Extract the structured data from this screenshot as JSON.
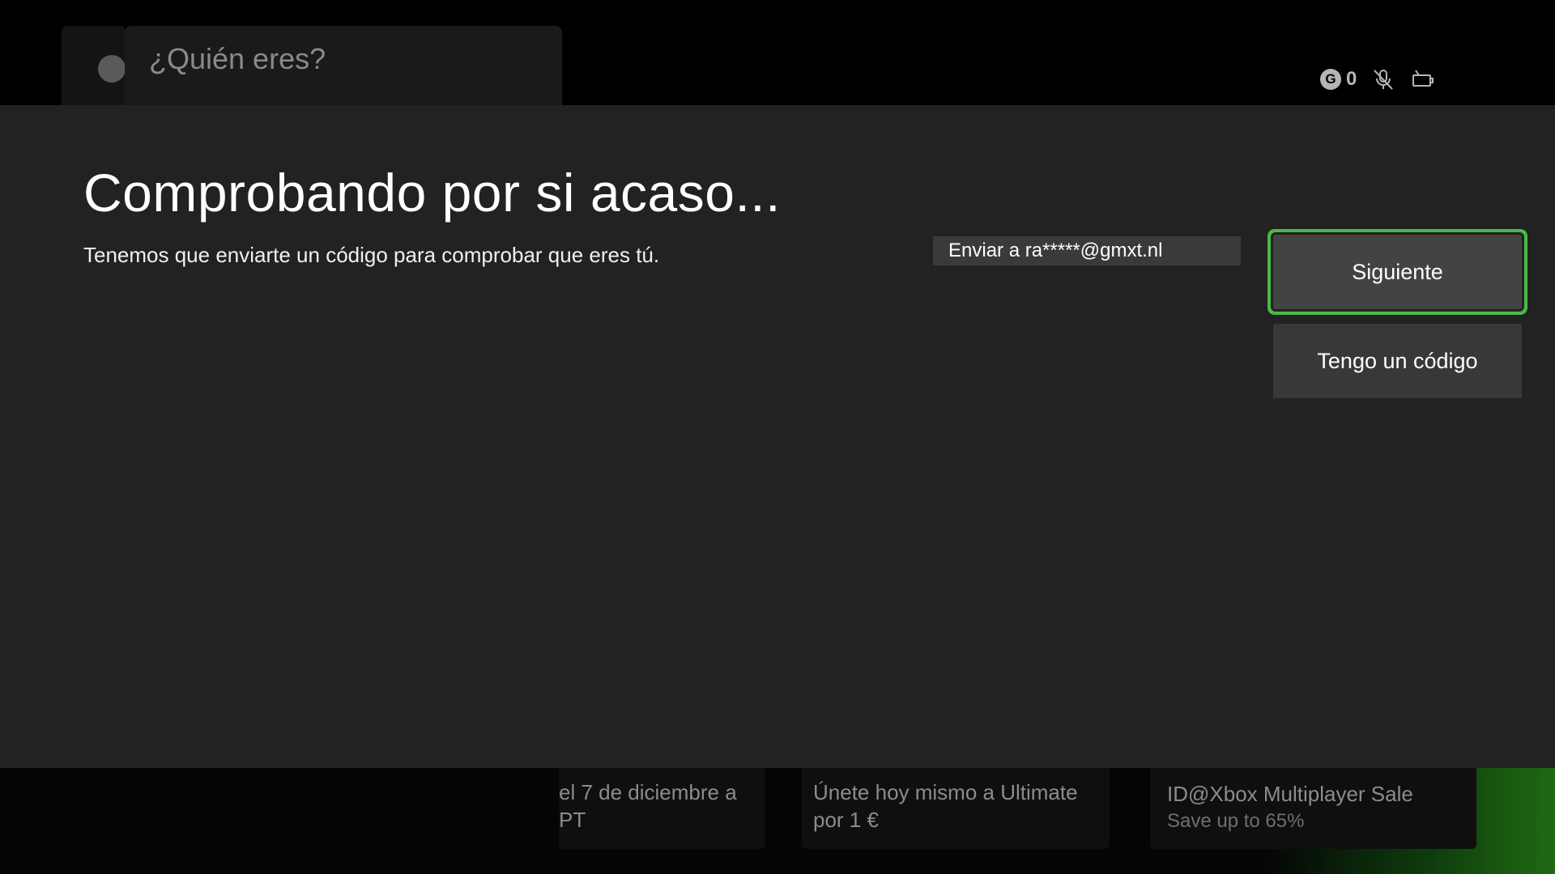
{
  "background": {
    "who_panel_title": "¿Quién eres?",
    "status": {
      "gamerscore": "0",
      "gamerscore_icon": "G"
    },
    "tiles": [
      {
        "line1": "el 7 de diciembre a",
        "line2": "PT"
      },
      {
        "line1": "Únete hoy mismo a Ultimate",
        "line2": "por 1 €"
      },
      {
        "line1": "ID@Xbox Multiplayer Sale",
        "line2": "Save up to 65%"
      }
    ]
  },
  "dialog": {
    "title": "Comprobando por si acaso...",
    "description": "Tenemos que enviarte un código para comprobar que eres tú.",
    "send_to": "Enviar a ra*****@gmxt.nl",
    "next_label": "Siguiente",
    "have_code_label": "Tengo un código"
  },
  "colors": {
    "focus": "#49b949",
    "dialog_bg": "#222222"
  }
}
